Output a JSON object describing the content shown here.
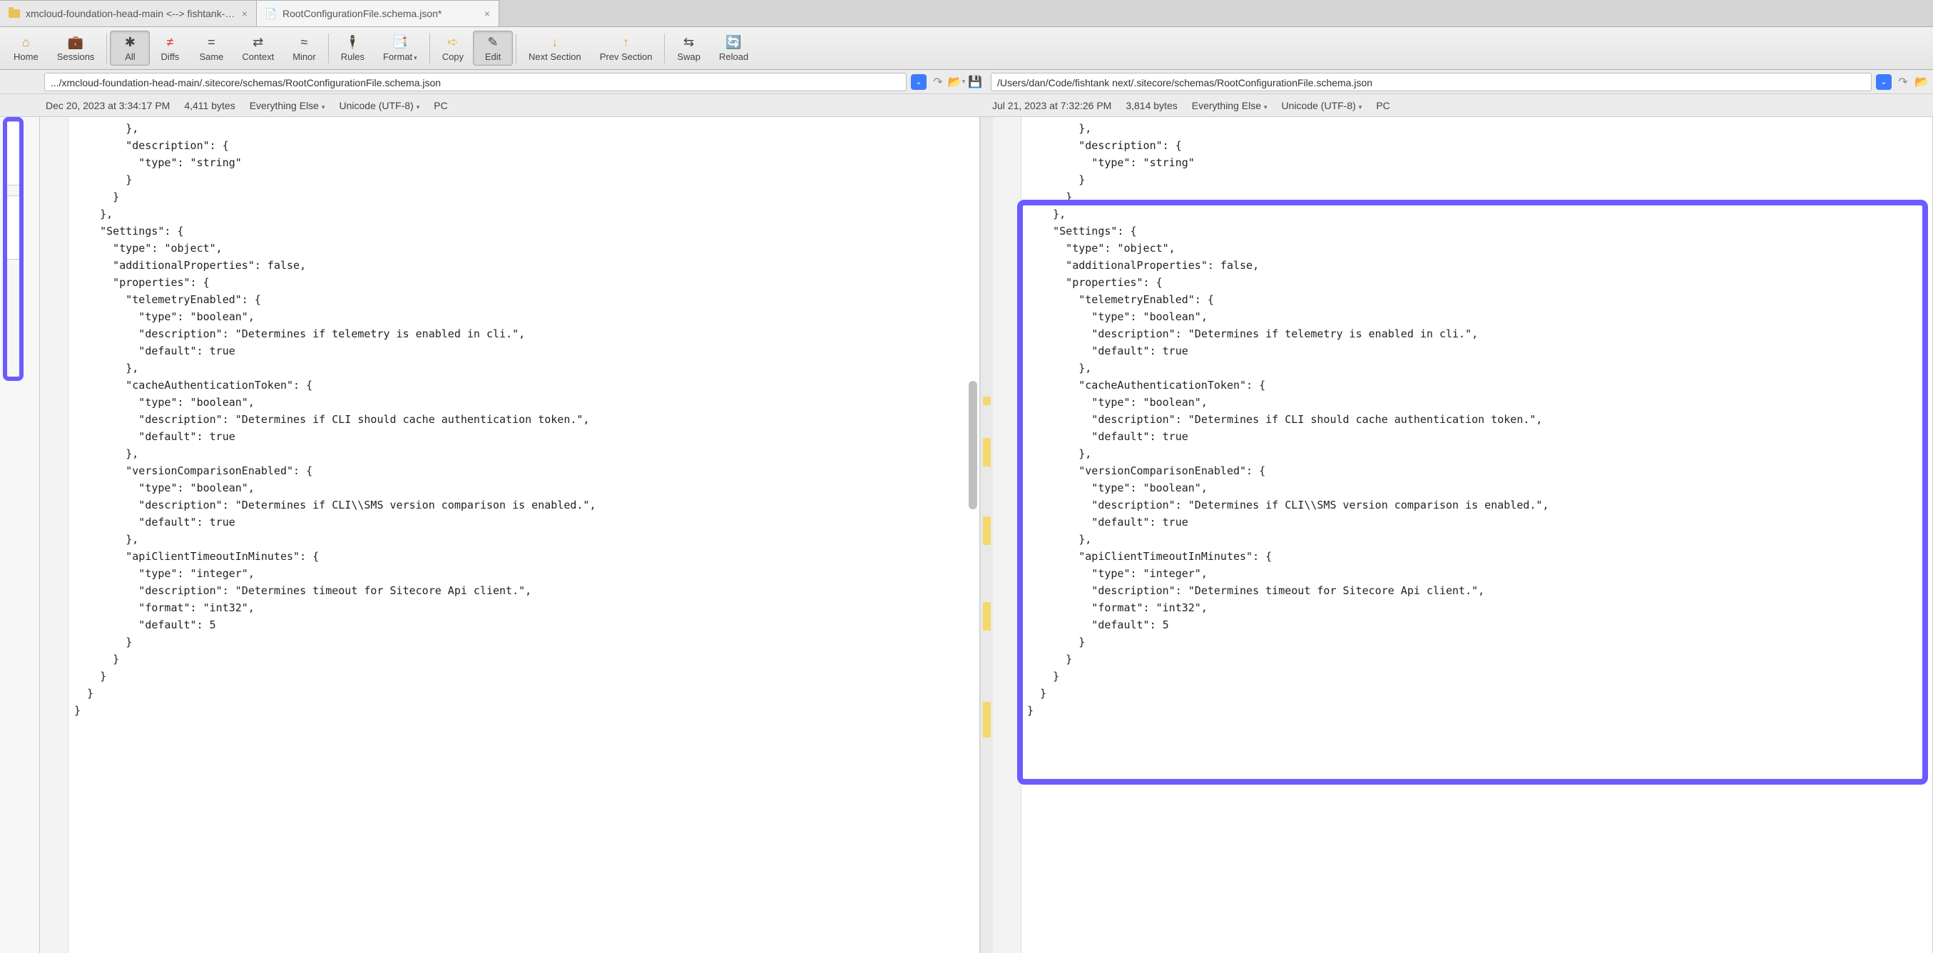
{
  "tabs": [
    {
      "label": "xmcloud-foundation-head-main <--> fishtank-n...",
      "active": false
    },
    {
      "label": "RootConfigurationFile.schema.json*",
      "active": true
    }
  ],
  "toolbar": {
    "home": "Home",
    "sessions": "Sessions",
    "all": "All",
    "diffs": "Diffs",
    "same": "Same",
    "context": "Context",
    "minor": "Minor",
    "rules": "Rules",
    "format": "Format",
    "copy": "Copy",
    "edit": "Edit",
    "next_section": "Next Section",
    "prev_section": "Prev Section",
    "swap": "Swap",
    "reload": "Reload"
  },
  "left": {
    "path": ".../xmcloud-foundation-head-main/.sitecore/schemas/RootConfigurationFile.schema.json",
    "timestamp": "Dec 20, 2023 at 3:34:17 PM",
    "bytes": "4,411 bytes",
    "filter": "Everything Else",
    "encoding": "Unicode (UTF-8)",
    "lineend": "PC",
    "code": "        },\n        \"description\": {\n          \"type\": \"string\"\n        }\n      }\n    },\n    \"Settings\": {\n      \"type\": \"object\",\n      \"additionalProperties\": false,\n      \"properties\": {\n        \"telemetryEnabled\": {\n          \"type\": \"boolean\",\n          \"description\": \"Determines if telemetry is enabled in cli.\",\n          \"default\": true\n        },\n        \"cacheAuthenticationToken\": {\n          \"type\": \"boolean\",\n          \"description\": \"Determines if CLI should cache authentication token.\",\n          \"default\": true\n        },\n        \"versionComparisonEnabled\": {\n          \"type\": \"boolean\",\n          \"description\": \"Determines if CLI\\\\SMS version comparison is enabled.\",\n          \"default\": true\n        },\n        \"apiClientTimeoutInMinutes\": {\n          \"type\": \"integer\",\n          \"description\": \"Determines timeout for Sitecore Api client.\",\n          \"format\": \"int32\",\n          \"default\": 5\n        }\n      }\n    }\n  }\n}"
  },
  "right": {
    "path": "/Users/dan/Code/fishtank next/.sitecore/schemas/RootConfigurationFile.schema.json",
    "timestamp": "Jul 21, 2023 at 7:32:26 PM",
    "bytes": "3,814 bytes",
    "filter": "Everything Else",
    "encoding": "Unicode (UTF-8)",
    "lineend": "PC",
    "code": "        },\n        \"description\": {\n          \"type\": \"string\"\n        }\n      }\n    },\n    \"Settings\": {\n      \"type\": \"object\",\n      \"additionalProperties\": false,\n      \"properties\": {\n        \"telemetryEnabled\": {\n          \"type\": \"boolean\",\n          \"description\": \"Determines if telemetry is enabled in cli.\",\n          \"default\": true\n        },\n        \"cacheAuthenticationToken\": {\n          \"type\": \"boolean\",\n          \"description\": \"Determines if CLI should cache authentication token.\",\n          \"default\": true\n        },\n        \"versionComparisonEnabled\": {\n          \"type\": \"boolean\",\n          \"description\": \"Determines if CLI\\\\SMS version comparison is enabled.\",\n          \"default\": true\n        },\n        \"apiClientTimeoutInMinutes\": {\n          \"type\": \"integer\",\n          \"description\": \"Determines timeout for Sitecore Api client.\",\n          \"format\": \"int32\",\n          \"default\": 5\n        }\n      }\n    }\n  }\n}"
  }
}
